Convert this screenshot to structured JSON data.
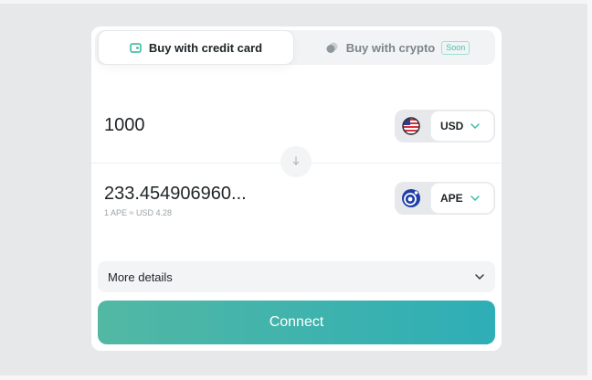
{
  "tabs": {
    "credit_card": {
      "label": "Buy with credit card",
      "icon": "credit-card-icon"
    },
    "crypto": {
      "label": "Buy with crypto",
      "badge": "Soon",
      "icon": "crypto-coins-icon"
    }
  },
  "pay": {
    "amount": "1000",
    "currency": "USD",
    "flag_icon": "us-flag-icon"
  },
  "receive": {
    "amount": "233.454906960...",
    "rate": "1 APE ≈ USD 4.28",
    "currency": "APE",
    "token_icon": "apecoin-icon"
  },
  "swap_icon": "arrow-down-icon",
  "details": {
    "label": "More details"
  },
  "connect": {
    "label": "Connect"
  },
  "colors": {
    "accent_start": "#52b8a3",
    "accent_end": "#2eaeb6",
    "badge": "#46c4a9",
    "background": "#e6e8ea"
  }
}
